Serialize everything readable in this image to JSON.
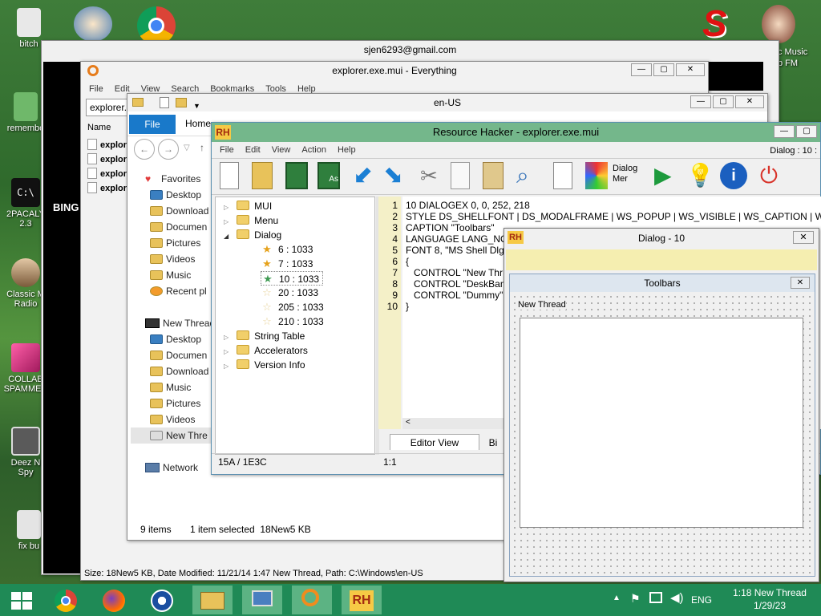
{
  "desktop": {
    "icons": [
      {
        "label": "bitch",
        "color": "#e5e5e5"
      },
      {
        "label": "remembe",
        "color": "#58a858"
      },
      {
        "label": "2PACALY\n2.3",
        "color": "#111111"
      },
      {
        "label": "Classic M\nRadio",
        "color": "#c9a27a"
      },
      {
        "label": "COLLAB\nSPAMMER",
        "color": "#e0307a"
      },
      {
        "label": "Deez N\nSpy",
        "color": "#555555"
      },
      {
        "label": "fix bu",
        "color": "#dddddd"
      }
    ],
    "right_icon_label": "c Music\nb FM",
    "behind_window_text": "BING"
  },
  "back_window": {
    "title": "sjen6293@gmail.com"
  },
  "everything": {
    "title": "explorer.exe.mui - Everything",
    "menu": [
      "File",
      "Edit",
      "View",
      "Search",
      "Bookmarks",
      "Tools",
      "Help"
    ],
    "search_value": "explorer.",
    "column_name": "Name",
    "files": [
      "explor",
      "explor",
      "explor",
      "explor"
    ],
    "status": "Size: 18New5 KB, Date Modified: 11/21/14 1:47 New Thread, Path: C:\\Windows\\en-US"
  },
  "enus": {
    "title": "en-US",
    "ribbon_tabs": [
      "File",
      "Home"
    ],
    "favorites_label": "Favorites",
    "favorites": [
      "Desktop",
      "Download",
      "Documen",
      "Pictures",
      "Videos",
      "Music",
      "Recent pl"
    ],
    "thispc_label": "New Thread",
    "thispc": [
      "Desktop",
      "Documen",
      "Download",
      "Music",
      "Pictures",
      "Videos",
      "New Thre"
    ],
    "network_label": "Network",
    "status_items": "9 items",
    "status_selected": "1 item selected  18New5 KB"
  },
  "reshacker": {
    "title": "Resource Hacker - explorer.exe.mui",
    "menu": [
      "File",
      "Edit",
      "View",
      "Action",
      "Help"
    ],
    "right_label": "Dialog : 10 :",
    "dialog_menu_btn": "Dialog\nMer",
    "tree": [
      {
        "label": "MUI",
        "type": "folder",
        "level": 0
      },
      {
        "label": "Menu",
        "type": "folder",
        "level": 0
      },
      {
        "label": "Dialog",
        "type": "folder-open",
        "level": 0
      },
      {
        "label": "6 : 1033",
        "type": "star",
        "level": 1
      },
      {
        "label": "7 : 1033",
        "type": "star",
        "level": 1
      },
      {
        "label": "10 : 1033",
        "type": "star-green",
        "level": 1
      },
      {
        "label": "20 : 1033",
        "type": "star-empty",
        "level": 1
      },
      {
        "label": "205 : 1033",
        "type": "star-empty",
        "level": 1
      },
      {
        "label": "210 : 1033",
        "type": "star-empty",
        "level": 1
      },
      {
        "label": "String Table",
        "type": "folder",
        "level": 0
      },
      {
        "label": "Accelerators",
        "type": "folder",
        "level": 0
      },
      {
        "label": "Version Info",
        "type": "folder",
        "level": 0
      }
    ],
    "line_numbers": [
      "1",
      "2",
      "3",
      "4",
      "5",
      "6",
      "7",
      "8",
      "9",
      "10"
    ],
    "code": [
      "10 DIALOGEX 0, 0, 252, 218",
      "STYLE DS_SHELLFONT | DS_MODALFRAME | WS_POPUP | WS_VISIBLE | WS_CAPTION | WS",
      "CAPTION \"Toolbars\"",
      "LANGUAGE LANG_NO",
      "FONT 8, \"MS Shell Dlg",
      "{",
      "   CONTROL \"New Thr",
      "   CONTROL \"DeskBan",
      "   CONTROL \"Dummy\"",
      "}"
    ],
    "tab_editor": "Editor View",
    "tab_binary": "Bi",
    "status_left": "15A / 1E3C",
    "status_mid": "1:1"
  },
  "dialog_preview": {
    "title": "Dialog - 10",
    "inner_title": "Toolbars",
    "label": "New Thread"
  },
  "taskbar": {
    "clock_time": "1:18 New Thread",
    "clock_date": "1/29/23",
    "language": "ENG"
  }
}
